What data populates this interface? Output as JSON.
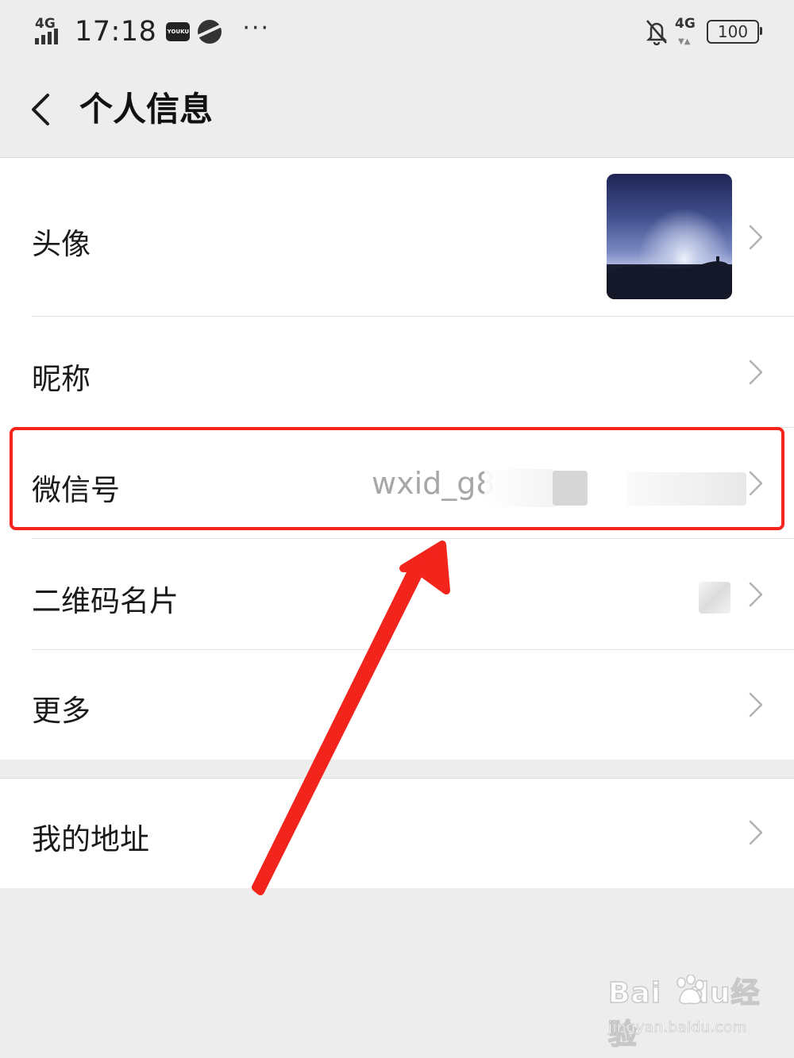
{
  "status_bar": {
    "network_left": "4G",
    "time": "17:18",
    "youku_label": "YOUKU",
    "more": "···",
    "network_right": "4G",
    "battery": "100"
  },
  "header": {
    "back_icon": "chevron-left-icon",
    "title": "个人信息"
  },
  "rows": [
    {
      "label": "头像",
      "value": "",
      "icon": "chevron-right-icon"
    },
    {
      "label": "昵称",
      "value": "",
      "icon": "chevron-right-icon"
    },
    {
      "label": "微信号",
      "value": "wxid_g8",
      "icon": "chevron-right-icon"
    },
    {
      "label": "二维码名片",
      "value": "",
      "icon": "chevron-right-icon"
    },
    {
      "label": "更多",
      "value": "",
      "icon": "chevron-right-icon"
    },
    {
      "label": "我的地址",
      "value": "",
      "icon": "chevron-right-icon"
    }
  ],
  "annotation": {
    "highlight_color": "#f2241c",
    "arrow_color": "#f2241c"
  },
  "watermark": {
    "brand_left": "Bai",
    "brand_right": "du",
    "brand_cn": "经验",
    "url": "jingyan.baidu.com"
  },
  "colors": {
    "background": "#ededed",
    "card": "#ffffff",
    "value_text": "#a7a7a7"
  }
}
